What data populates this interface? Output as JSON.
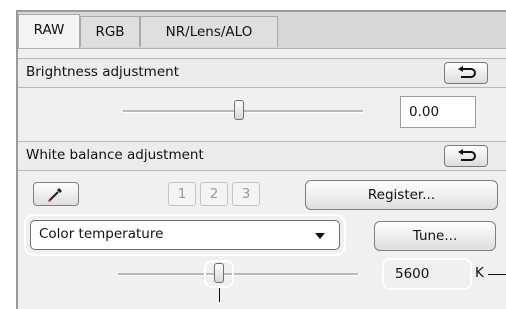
{
  "tabs": [
    {
      "label": "RAW",
      "active": true
    },
    {
      "label": "RGB",
      "active": false
    },
    {
      "label": "NR/Lens/ALO",
      "active": false
    }
  ],
  "brightness": {
    "title": "Brightness adjustment",
    "value": "0.00",
    "slider_fraction": 0.5,
    "reset_icon": "undo-arrow-icon"
  },
  "white_balance": {
    "title": "White balance adjustment",
    "reset_icon": "undo-arrow-icon",
    "eyedropper_icon": "eyedropper-icon",
    "presets": [
      "1",
      "2",
      "3"
    ],
    "register_label": "Register...",
    "mode_selected": "Color temperature",
    "tune_label": "Tune...",
    "temperature_value": "5600",
    "temperature_unit": "K"
  },
  "colors": {
    "panel_bg": "#f0f0f0",
    "tab_bg": "#d7d7d7",
    "highlight_ring": "#ffffff"
  }
}
